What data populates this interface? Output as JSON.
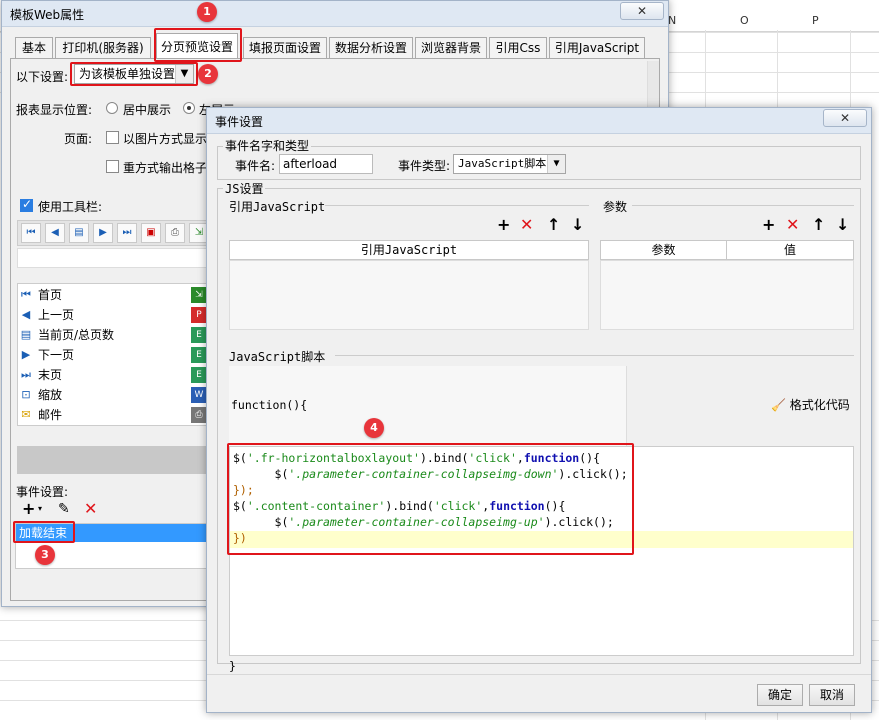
{
  "sheet": {
    "columns": [
      "N",
      "O",
      "P"
    ]
  },
  "main_window": {
    "title": "模板Web属性",
    "close": "✕",
    "tabs": [
      "基本",
      "打印机(服务器)",
      "分页预览设置",
      "填报页面设置",
      "数据分析设置",
      "浏览器背景",
      "引用Css",
      "引用JavaScript"
    ],
    "active_tab": 2,
    "settings_label": "以下设置:",
    "settings_value": "为该模板单独设置",
    "position_label": "报表显示位置:",
    "position_center": "居中展示",
    "position_left": "左展示",
    "page_label": "页面:",
    "page_opt1": "以图片方式显示",
    "page_opt2": "重方式输出格子",
    "toolbar_label": "使用工具栏:",
    "toolbar_items": [
      {
        "label": "首页",
        "icon": "first-page-icon",
        "glyph": "⏮"
      },
      {
        "label": "上一页",
        "icon": "prev-page-icon",
        "glyph": "◀"
      },
      {
        "label": "当前页/总页数",
        "icon": "page-count-icon",
        "glyph": "▤"
      },
      {
        "label": "下一页",
        "icon": "next-page-icon",
        "glyph": "▶"
      },
      {
        "label": "末页",
        "icon": "last-page-icon",
        "glyph": "⏭"
      },
      {
        "label": "缩放",
        "icon": "zoom-icon",
        "glyph": "⊡"
      },
      {
        "label": "邮件",
        "icon": "mail-icon",
        "glyph": "✉"
      }
    ],
    "event_label": "事件设置:",
    "event_item": "加载结束"
  },
  "event_dialog": {
    "title": "事件设置",
    "close": "✕",
    "group_name_type": "事件名字和类型",
    "event_name_label": "事件名:",
    "event_name_value": "afterload",
    "event_type_label": "事件类型:",
    "event_type_value": "JavaScript脚本",
    "group_js": "JS设置",
    "ref_js_label": "引用JavaScript",
    "ref_js_col": "引用JavaScript",
    "params_label": "参数",
    "params_col1": "参数",
    "params_col2": "值",
    "script_label": "JavaScript脚本",
    "func_header": "function(){",
    "format_code": "格式化代码",
    "func_footer": "}",
    "ok": "确定",
    "cancel": "取消"
  },
  "code_lines": [
    [
      [
        "$(",
        ""
      ],
      [
        "'.fr-horizontalboxlayout'",
        "cs"
      ],
      [
        ").bind(",
        ""
      ],
      [
        "'click'",
        "cs"
      ],
      [
        ",",
        ""
      ],
      [
        "function",
        "ck"
      ],
      [
        "(){",
        ""
      ]
    ],
    [
      [
        "      $(",
        ""
      ],
      [
        "'.parameter-container-collapseimg-down'",
        "ci"
      ],
      [
        ").click();",
        ""
      ]
    ],
    [
      [
        "});",
        "cp"
      ]
    ],
    [
      [
        "$(",
        ""
      ],
      [
        "'.content-container'",
        "cs"
      ],
      [
        ").bind(",
        ""
      ],
      [
        "'click'",
        "cs"
      ],
      [
        ",",
        ""
      ],
      [
        "function",
        "ck"
      ],
      [
        "(){",
        ""
      ]
    ],
    [
      [
        "      $(",
        ""
      ],
      [
        "'.parameter-container-collapseimg-up'",
        "ci"
      ],
      [
        ").click();",
        ""
      ]
    ],
    [
      [
        "})",
        "cp"
      ]
    ]
  ],
  "annotations": [
    "1",
    "2",
    "3",
    "4"
  ],
  "colors": {
    "annotation_red": "#e0151b",
    "selection_blue": "#3399ff",
    "highlight_line": "#ffffcc"
  }
}
